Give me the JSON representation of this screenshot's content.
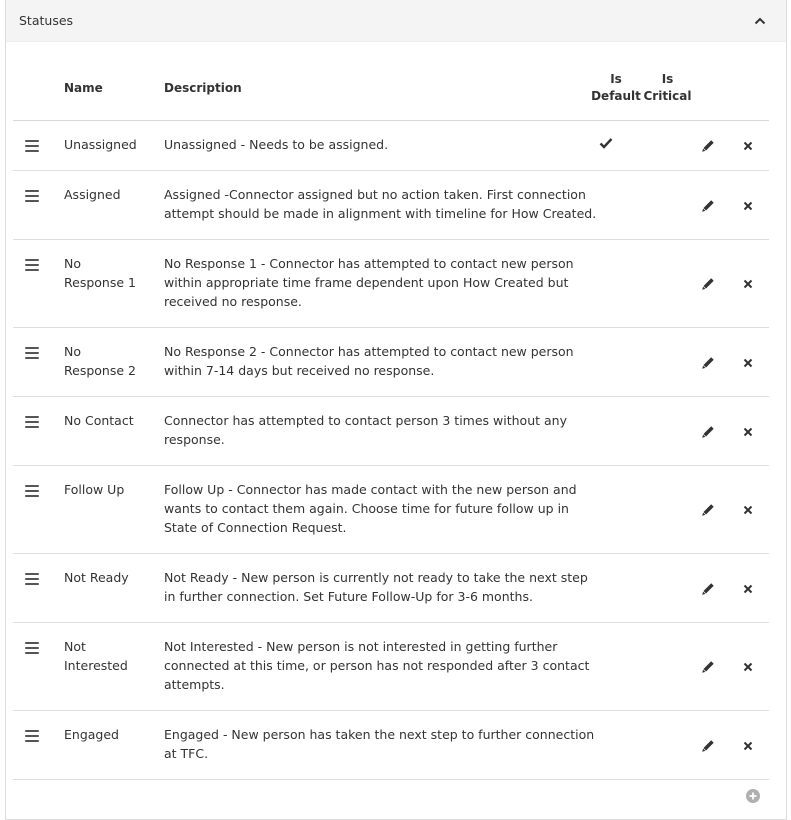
{
  "panel": {
    "title": "Statuses",
    "collapse_icon": "chevron-up-icon"
  },
  "columns": {
    "name": "Name",
    "description": "Description",
    "is_default_1": "Is",
    "is_default_2": "Default",
    "is_critical_1": "Is",
    "is_critical_2": "Critical"
  },
  "rows": [
    {
      "name_lines": [
        "Unassigned"
      ],
      "desc_lines": [
        "Unassigned - Needs to be assigned."
      ],
      "is_default": true
    },
    {
      "name_lines": [
        "Assigned"
      ],
      "desc_lines": [
        "Assigned -Connector assigned but no action taken. First connection",
        "attempt should be made in alignment with timeline for How Created."
      ],
      "is_default": false
    },
    {
      "name_lines": [
        "No",
        "Response 1"
      ],
      "desc_lines": [
        "No Response 1 - Connector has attempted to contact new person",
        "within appropriate time frame dependent upon How Created but",
        "received no response."
      ],
      "is_default": false
    },
    {
      "name_lines": [
        "No",
        "Response 2"
      ],
      "desc_lines": [
        "No Response 2 - Connector has attempted to contact new person",
        "within 7-14 days but received no response."
      ],
      "is_default": false
    },
    {
      "name_lines": [
        "No Contact"
      ],
      "desc_lines": [
        "Connector has attempted to contact person 3 times without any",
        "response."
      ],
      "is_default": false
    },
    {
      "name_lines": [
        "Follow Up"
      ],
      "desc_lines": [
        "Follow Up - Connector has made contact with the new person and",
        "wants to contact them again. Choose time for future follow up in",
        "State of Connection Request."
      ],
      "is_default": false
    },
    {
      "name_lines": [
        "Not Ready"
      ],
      "desc_lines": [
        "Not Ready - New person is currently not ready to take the next step",
        "in further connection. Set Future Follow-Up for 3-6 months."
      ],
      "is_default": false
    },
    {
      "name_lines": [
        "Not",
        "Interested"
      ],
      "desc_lines": [
        "Not Interested - New person is not interested in getting further",
        "connected at this time, or person has not responded after 3 contact",
        "attempts."
      ],
      "is_default": false
    },
    {
      "name_lines": [
        "Engaged"
      ],
      "desc_lines": [
        "Engaged - New person has taken the next step to further connection",
        "at TFC."
      ],
      "is_default": false
    }
  ],
  "icons": {
    "drag": "drag-handle-icon",
    "default": "checkmark-icon",
    "edit": "pencil-icon",
    "delete": "close-icon",
    "add": "add-circle-icon"
  }
}
